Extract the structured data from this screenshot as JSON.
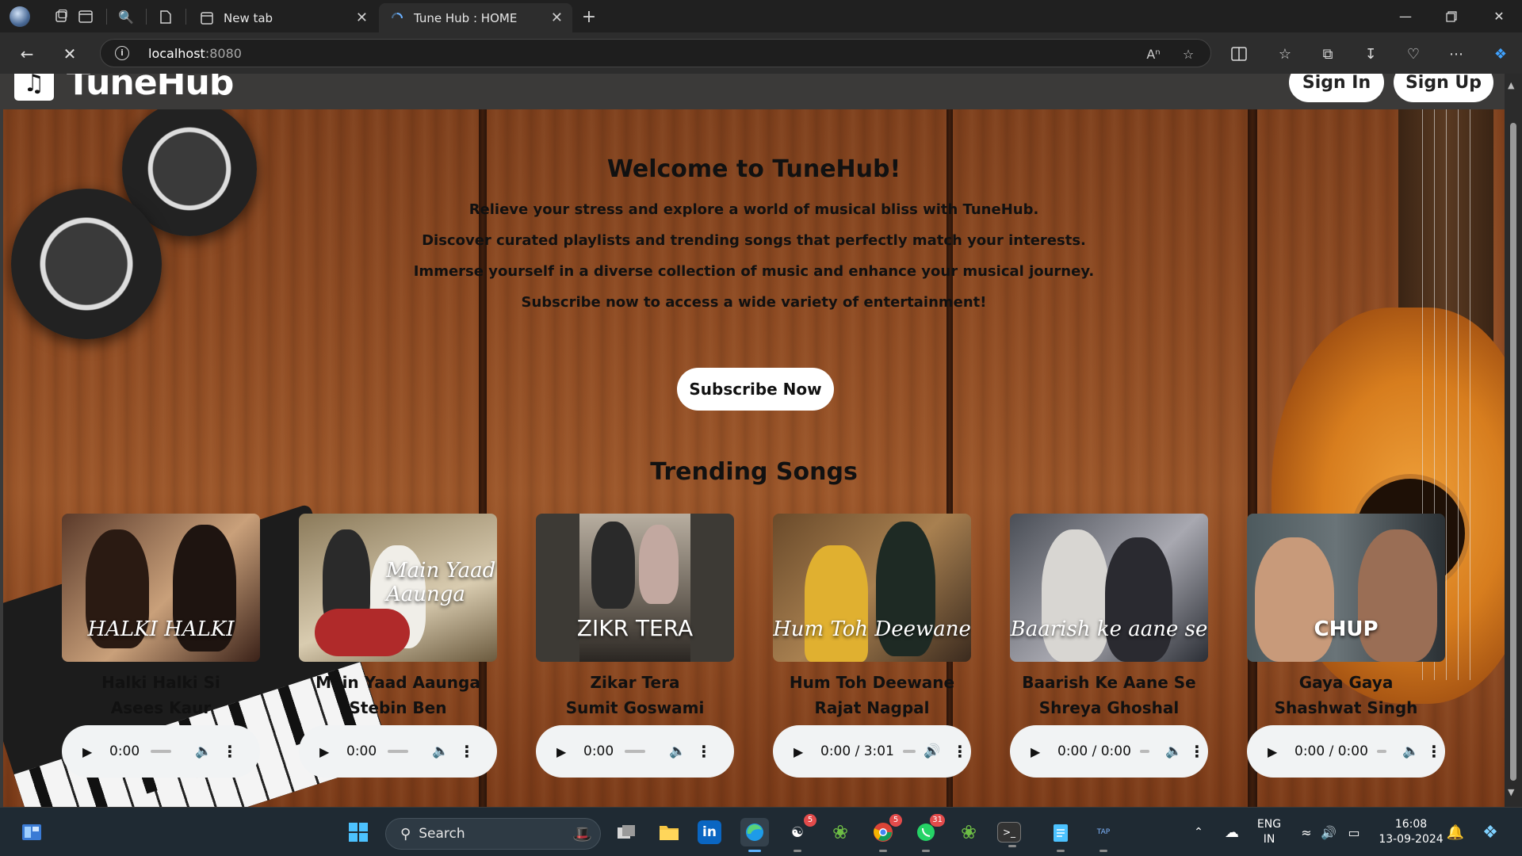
{
  "browser": {
    "tabs": [
      {
        "label": "New tab"
      },
      {
        "label": "Tune Hub : HOME"
      }
    ],
    "address": {
      "host": "localhost",
      "port": ":8080"
    }
  },
  "site": {
    "logo_text": "TuneHub",
    "signin_label": "Sign In",
    "signup_label": "Sign Up",
    "welcome_title": "Welcome to TuneHub!",
    "lines": [
      "Relieve your stress and explore a world of musical bliss with TuneHub.",
      "Discover curated playlists and trending songs that perfectly match your interests.",
      "Immerse yourself in a diverse collection of music and enhance your musical journey.",
      "Subscribe now to access a wide variety of entertainment!"
    ],
    "subscribe_label": "Subscribe Now",
    "trending_title": "Trending Songs"
  },
  "songs": [
    {
      "title": "Halki Halki Si",
      "artist": "Asees Kaur",
      "time": "0:00",
      "cover_caption": "HALKI HALKI",
      "cover_colors": [
        "#5b3a2a",
        "#c9a07a",
        "#3a2118"
      ]
    },
    {
      "title": "Main Yaad Aaunga",
      "artist": "Stebin Ben",
      "time": "0:00",
      "cover_caption": "Main Yaad Aaunga",
      "cover_colors": [
        "#8b7a5a",
        "#d9ccb0",
        "#b02a2a"
      ]
    },
    {
      "title": "Zikar Tera",
      "artist": "Sumit Goswami",
      "time": "0:00",
      "cover_caption": "ZIKR TERA",
      "cover_colors": [
        "#3d3d3d",
        "#9a8f80",
        "#2a2a2a"
      ]
    },
    {
      "title": "Hum Toh Deewane",
      "artist": "Rajat Nagpal",
      "time": "0:00 / 3:01",
      "cover_caption": "Hum Toh Deewane",
      "cover_colors": [
        "#6a4a2a",
        "#e0b030",
        "#2a3a30"
      ]
    },
    {
      "title": "Baarish Ke Aane Se",
      "artist": "Shreya Ghoshal",
      "time": "0:00 / 0:00",
      "cover_caption": "Baarish ke aane se",
      "cover_colors": [
        "#4a4e56",
        "#a8a8b0",
        "#2b2e35"
      ]
    },
    {
      "title": "Gaya Gaya",
      "artist": "Shashwat Singh",
      "time": "0:00 / 0:00",
      "cover_caption": "CHUP",
      "cover_colors": [
        "#4d5a5e",
        "#c89a7a",
        "#2a3034"
      ]
    }
  ],
  "taskbar": {
    "search_label": "Search",
    "language": "ENG",
    "region": "IN",
    "time": "16:08",
    "date": "13-09-2024",
    "badges": {
      "copilot": "5",
      "chrome": "5",
      "whatsapp": "31"
    }
  }
}
